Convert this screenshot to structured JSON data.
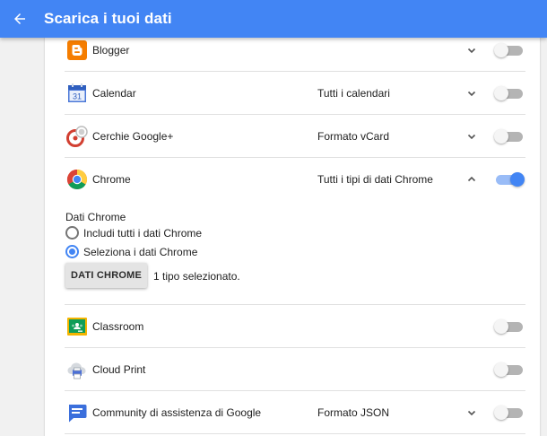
{
  "header": {
    "title": "Scarica i tuoi dati",
    "back_icon": "arrow-back-icon"
  },
  "colors": {
    "accent": "#4285f4",
    "header_bg": "#4285f4",
    "page_bg": "#f1f1f1"
  },
  "services": [
    {
      "name": "Blogger",
      "icon": "blogger-icon",
      "format": "",
      "expand": "chevron-down",
      "enabled": false
    },
    {
      "name": "Calendar",
      "icon": "calendar-icon",
      "format": "Tutti i calendari",
      "expand": "chevron-down",
      "enabled": false
    },
    {
      "name": "Cerchie Google+",
      "icon": "google-plus-circles-icon",
      "format": "Formato vCard",
      "expand": "chevron-down",
      "enabled": false
    },
    {
      "name": "Chrome",
      "icon": "chrome-icon",
      "format": "Tutti i tipi di dati Chrome",
      "expand": "chevron-up",
      "enabled": true
    },
    {
      "name": "Classroom",
      "icon": "classroom-icon",
      "format": "",
      "expand": "",
      "enabled": false
    },
    {
      "name": "Cloud Print",
      "icon": "cloud-print-icon",
      "format": "",
      "expand": "",
      "enabled": false
    },
    {
      "name": "Community di assistenza di Google",
      "icon": "community-chat-icon",
      "format": "Formato JSON",
      "expand": "chevron-down",
      "enabled": false
    }
  ],
  "chrome_detail": {
    "label": "Dati Chrome",
    "options": [
      {
        "label": "Includi tutti i dati Chrome",
        "selected": false
      },
      {
        "label": "Seleziona i dati Chrome",
        "selected": true
      }
    ],
    "button_label": "DATI CHROME",
    "selection_status": "1 tipo selezionato."
  }
}
